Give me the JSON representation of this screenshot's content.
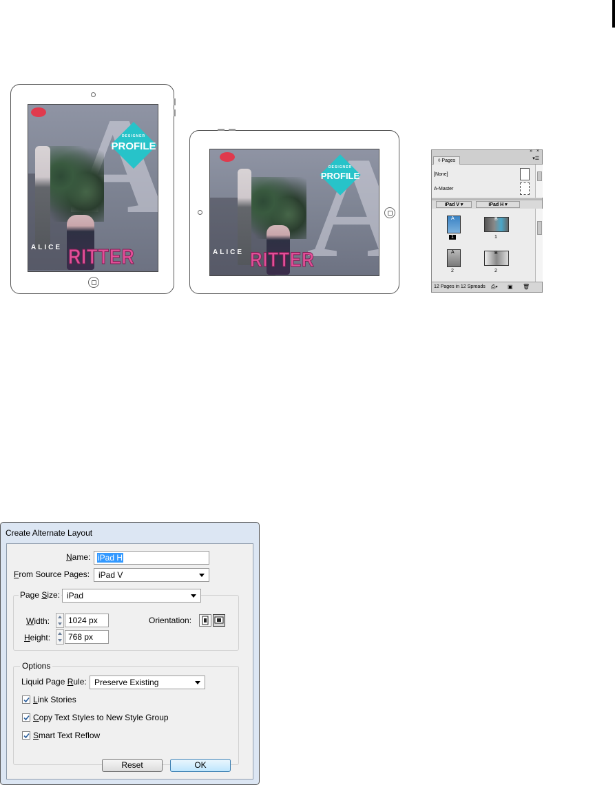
{
  "tablet_vertical": {
    "cover": {
      "big_letter": "A",
      "kicker": "DESIGNER",
      "headline": "PROFILE",
      "first_name": "ALICE",
      "last_name": "RITTER"
    }
  },
  "tablet_horizontal": {
    "cover": {
      "big_letter": "A",
      "kicker": "DESIGNER",
      "headline": "PROFILE",
      "first_name": "ALICE",
      "last_name": "RITTER"
    }
  },
  "pages_panel": {
    "tab_label": "Pages",
    "masters": [
      {
        "label": "[None]"
      },
      {
        "label": "A-Master"
      }
    ],
    "layouts": [
      {
        "label": "iPad V"
      },
      {
        "label": "iPad H"
      }
    ],
    "page_rows": [
      {
        "v_master": "A",
        "v_number": "1",
        "h_master": "B",
        "h_number": "1"
      },
      {
        "v_master": "A",
        "v_number": "2",
        "h_master": "B",
        "h_number": "2"
      }
    ],
    "status": "12 Pages in 12 Spreads",
    "colors": {
      "selected_number_bg": "#000000"
    }
  },
  "dialog": {
    "title": "Create Alternate Layout",
    "name_label": "Name:",
    "name_value": "iPad H",
    "source_label": "From Source Pages:",
    "source_value": "iPad V",
    "page_size_label": "Page Size:",
    "page_size_value": "iPad",
    "width_label": "Width:",
    "width_value": "1024 px",
    "height_label": "Height:",
    "height_value": "768 px",
    "orientation_label": "Orientation:",
    "orientation_selected": "landscape",
    "options_label": "Options",
    "liquid_label": "Liquid Page Rule:",
    "liquid_value": "Preserve Existing",
    "checkboxes": [
      {
        "label": "Link Stories",
        "checked": true
      },
      {
        "label": "Copy Text Styles to New Style Group",
        "checked": true
      },
      {
        "label": "Smart Text Reflow",
        "checked": true
      }
    ],
    "reset_label": "Reset",
    "ok_label": "OK"
  },
  "colors": {
    "accent_teal": "#27c3c9",
    "accent_pink": "#e24f98",
    "selection_blue": "#3399ff"
  }
}
